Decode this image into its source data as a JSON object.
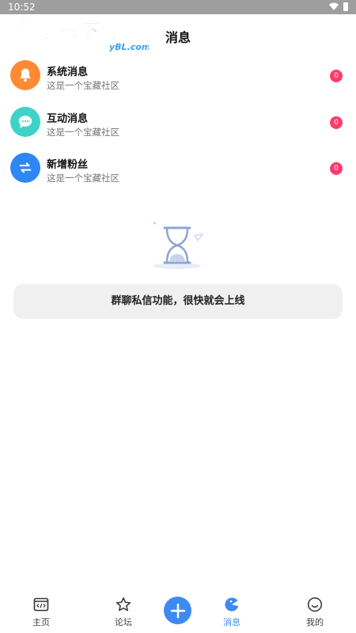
{
  "status_bar": {
    "time": "10:52"
  },
  "watermark": {
    "title": "游吧乐下载",
    "url": "yBL.com"
  },
  "header": {
    "title": "消息"
  },
  "messages": [
    {
      "title": "系统消息",
      "subtitle": "这是一个宝藏社区",
      "badge": "0",
      "color": "#ff8a33",
      "icon": "bell-icon"
    },
    {
      "title": "互动消息",
      "subtitle": "这是一个宝藏社区",
      "badge": "0",
      "color": "#3fd3c8",
      "icon": "chat-bubble-icon"
    },
    {
      "title": "新增粉丝",
      "subtitle": "这是一个宝藏社区",
      "badge": "0",
      "color": "#2f86f5",
      "icon": "swap-arrows-icon"
    }
  ],
  "empty_state": {
    "icon": "hourglass-icon",
    "notice": "群聊私信功能，很快就会上线"
  },
  "bottom_nav": {
    "items": [
      {
        "label": "主页",
        "icon": "code-window-icon"
      },
      {
        "label": "论坛",
        "icon": "star-icon"
      },
      {
        "label": "消息",
        "icon": "message-chomp-icon",
        "active": true
      },
      {
        "label": "我的",
        "icon": "smiley-icon"
      }
    ],
    "add_icon": "plus-icon"
  },
  "colors": {
    "accent": "#3d8bf2",
    "badge": "#ff3b6b",
    "notice_bg": "#f0f0f0"
  }
}
